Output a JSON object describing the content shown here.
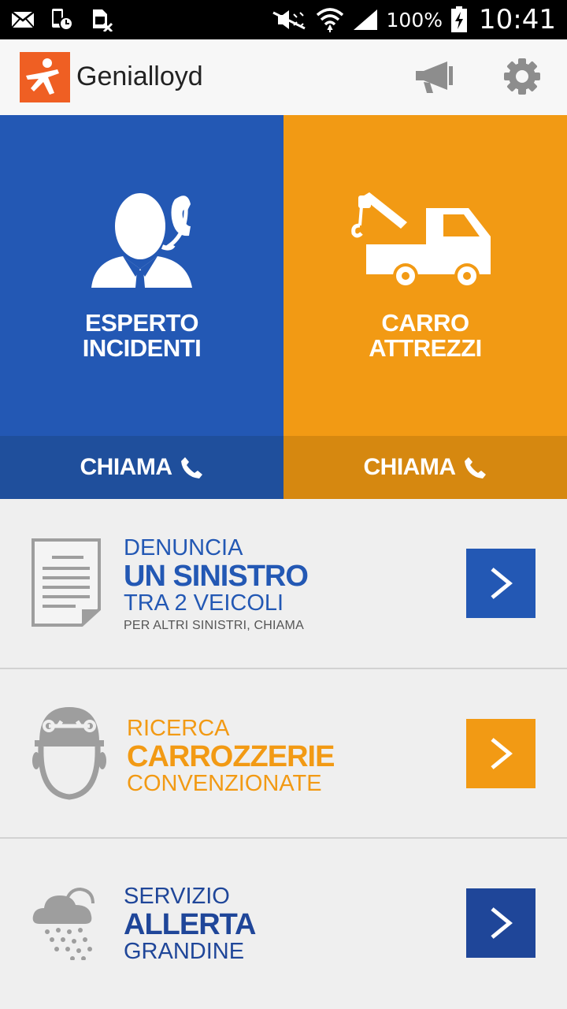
{
  "status_bar": {
    "icons": [
      "email-icon",
      "phone-timer-icon",
      "sim-off-icon",
      "mute-icon",
      "wifi-icon",
      "signal-icon",
      "battery-icon"
    ],
    "battery": "100%",
    "time": "10:41"
  },
  "app_bar": {
    "title": "Genialloyd",
    "brand_color": "#ef5f23"
  },
  "tiles": [
    {
      "title_line1": "ESPERTO",
      "title_line2": "INCIDENTI",
      "call_label": "CHIAMA",
      "color": "#2358b4"
    },
    {
      "title_line1": "CARRO",
      "title_line2": "ATTREZZI",
      "call_label": "CHIAMA",
      "color": "#f29a14"
    }
  ],
  "rows": [
    {
      "line1": "DENUNCIA",
      "line2": "UN SINISTRO",
      "line3": "TRA 2 VEICOLI",
      "note": "PER ALTRI SINISTRI, CHIAMA",
      "color": "#2358b4"
    },
    {
      "line1": "RICERCA",
      "line2": "CARROZZERIE",
      "line3": "CONVENZIONATE",
      "color": "#f29a14"
    },
    {
      "line1": "SERVIZIO",
      "line2": "ALLERTA",
      "line3": "GRANDINE",
      "color": "#1f4699"
    }
  ]
}
